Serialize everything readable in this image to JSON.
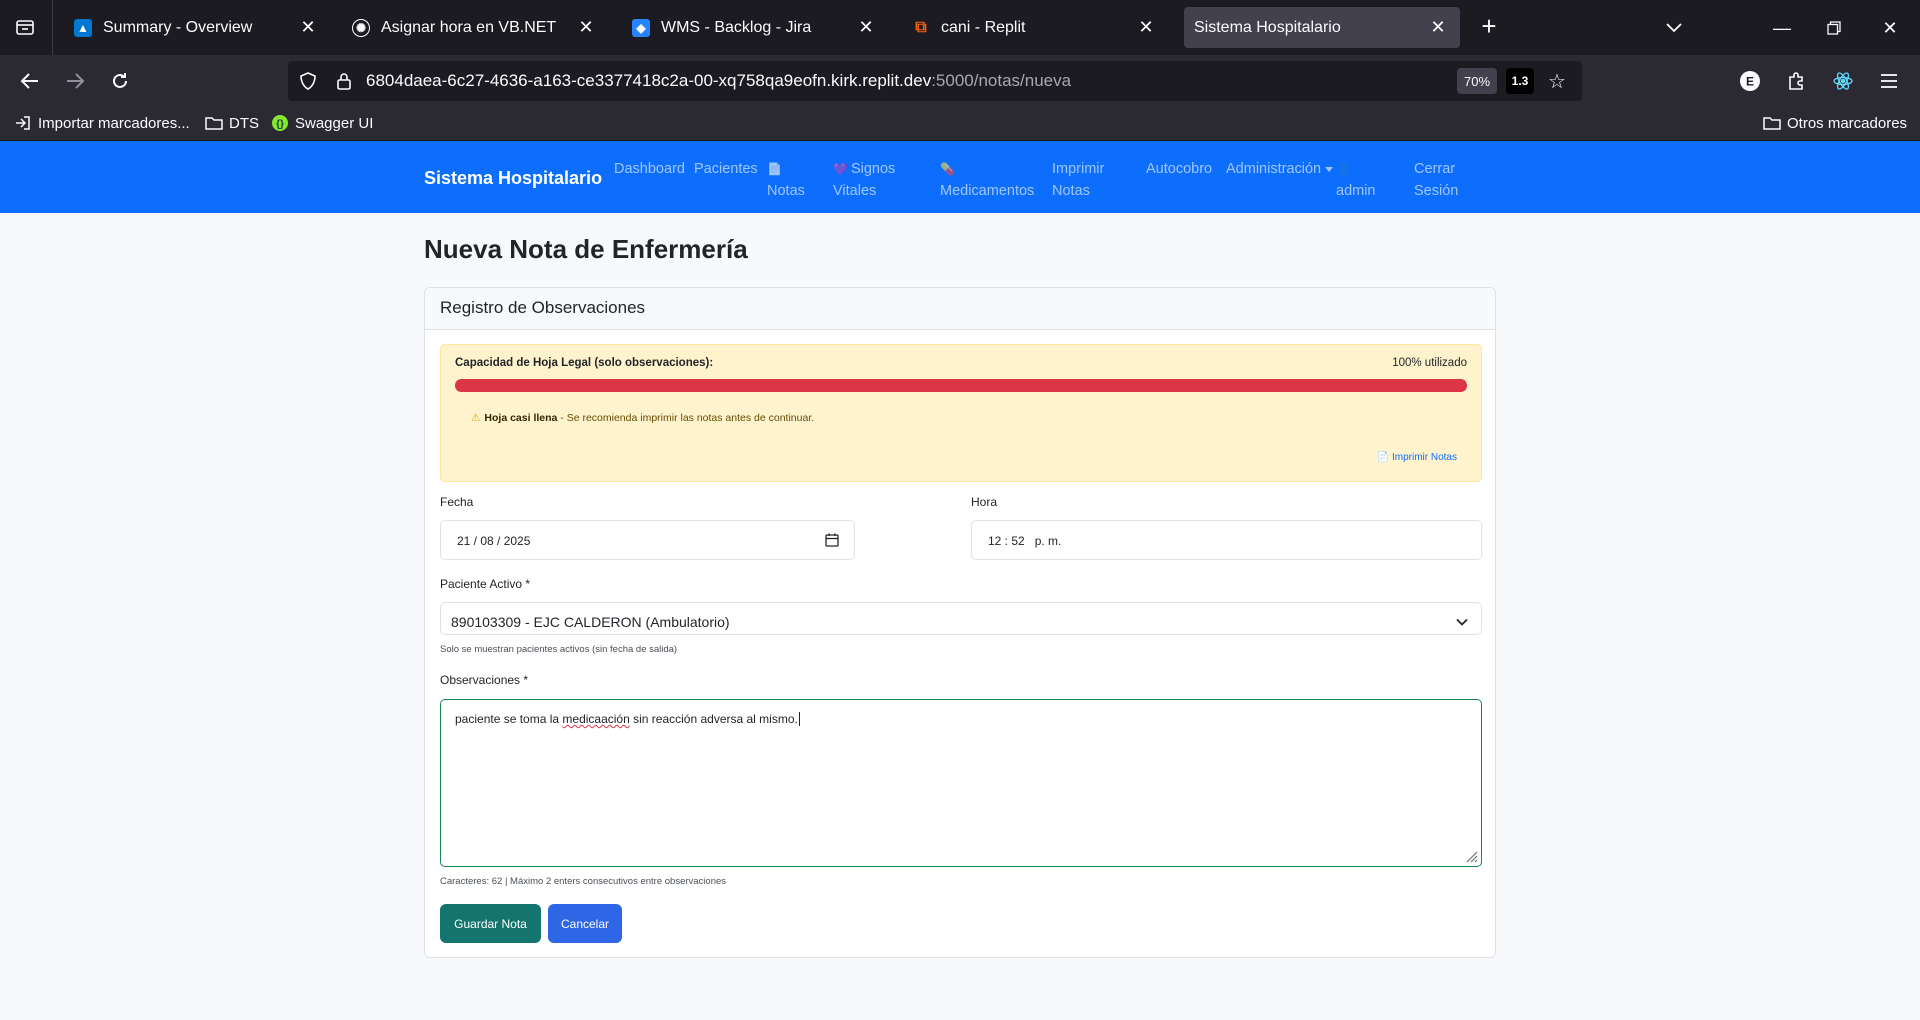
{
  "browser": {
    "tabs": [
      {
        "label": "Summary - Overview",
        "icon": "azure-devops-icon",
        "active": false
      },
      {
        "label": "Asignar hora en VB.NET",
        "icon": "chatgpt-icon",
        "active": false
      },
      {
        "label": "WMS - Backlog - Jira",
        "icon": "jira-icon",
        "active": false
      },
      {
        "label": "cani - Replit",
        "icon": "replit-icon",
        "active": false
      },
      {
        "label": "Sistema Hospitalario",
        "icon": "none",
        "active": true
      }
    ],
    "url": {
      "host": "6804daea-6c27-4636-a163-ce3377418c2a-00-xq758qa9eofn.kirk.replit.dev",
      "rest": ":5000/notas/nueva"
    },
    "zoom": "70%",
    "extension_badge": "1.3",
    "bookmarks": {
      "import": "Importar marcadores...",
      "dts": "DTS",
      "swagger": "Swagger UI",
      "other": "Otros marcadores"
    }
  },
  "app": {
    "brand": "Sistema Hospitalario",
    "nav": {
      "dashboard": "Dashboard",
      "pacientes": "Pacientes",
      "notas_icon": "📄",
      "notas": "Notas",
      "signos_icon": "💜",
      "signos_1": "Signos",
      "signos_2": "Vitales",
      "med_icon": "💊",
      "medicamentos": "Medicamentos",
      "imprimir_1": "Imprimir",
      "imprimir_2": "Notas",
      "autocobro": "Autocobro",
      "administracion": "Administración",
      "user_icon": "👤",
      "admin": "admin",
      "cerrar_1": "Cerrar",
      "cerrar_2": "Sesión"
    }
  },
  "page": {
    "title": "Nueva Nota de Enfermería",
    "card_header": "Registro de Observaciones",
    "capacity": {
      "label": "Capacidad de Hoja Legal (solo observaciones):",
      "used_text": "100% utilizado",
      "percent": 100,
      "warning_icon": "⚠",
      "warning_bold": "Hoja casi llena",
      "warning_text": " - Se recomienda imprimir las notas antes de continuar.",
      "print_icon": "📄",
      "print_link": "Imprimir Notas"
    },
    "form": {
      "fecha_label": "Fecha",
      "fecha_value": "21 / 08 / 2025",
      "hora_label": "Hora",
      "hora_value": "12 : 52   p. m.",
      "paciente_label": "Paciente Activo *",
      "paciente_value": "890103309 - EJC CALDERON (Ambulatorio)",
      "paciente_help": "Solo se muestran pacientes activos (sin fecha de salida)",
      "obs_label": "Observaciones *",
      "obs_before": "paciente se toma la ",
      "obs_misspelled": "medicaación",
      "obs_after": " sin reacción adversa al mismo.",
      "obs_help": "Caracteres: 62 | Máximo 2 enters consecutivos entre observaciones",
      "save_button": "Guardar Nota",
      "cancel_button": "Cancelar"
    }
  }
}
